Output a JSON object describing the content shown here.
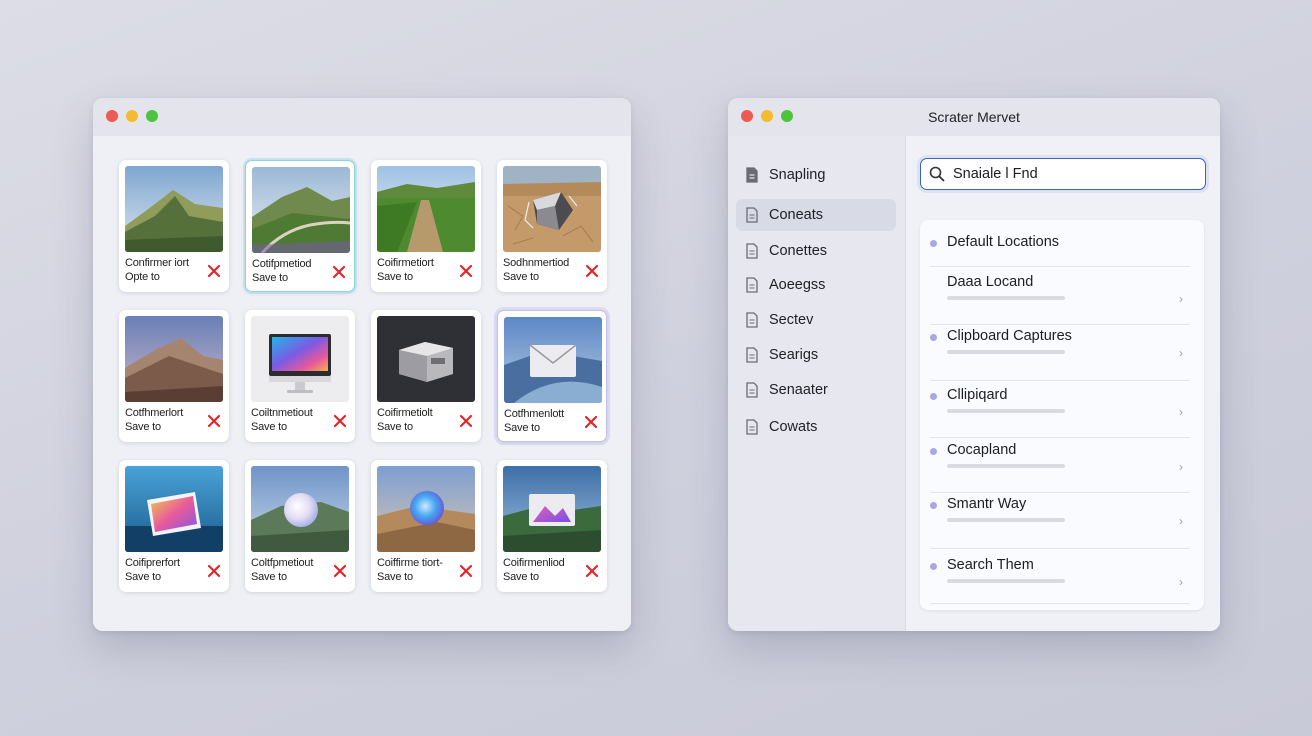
{
  "left_window": {
    "cards": [
      {
        "line1": "Confirmer iort",
        "line2": "Opte to",
        "thumb": "mountain-green"
      },
      {
        "line1": "Cotifpmetiod",
        "line2": "Save to",
        "thumb": "mountain-road"
      },
      {
        "line1": "Coifirmetiort",
        "line2": "Save to",
        "thumb": "field-path"
      },
      {
        "line1": "Sodhnmertiod",
        "line2": "Save to",
        "thumb": "desert-box"
      },
      {
        "line1": "Cotfhmerlort",
        "line2": "Save to",
        "thumb": "mountain-dusk"
      },
      {
        "line1": "Coiltnmetiout",
        "line2": "Save to",
        "thumb": "imac"
      },
      {
        "line1": "Coifirmetiolt",
        "line2": "Save to",
        "thumb": "box-dark"
      },
      {
        "line1": "Cotfhmenlott",
        "line2": "Save to",
        "thumb": "envelope-road"
      },
      {
        "line1": "Coifiprerfort",
        "line2": "Save to",
        "thumb": "folder-colorful"
      },
      {
        "line1": "Coltfpmetiout",
        "line2": "Save to",
        "thumb": "orb-mountain"
      },
      {
        "line1": "Coiffirme tiort-",
        "line2": "Save to",
        "thumb": "orb-desert"
      },
      {
        "line1": "Coifirmenliod",
        "line2": "Save to",
        "thumb": "envelope-forest"
      }
    ]
  },
  "right_window": {
    "title": "Scrater Mervet",
    "sidebar": [
      {
        "label": "Snapling",
        "icon": "document-icon"
      },
      {
        "label": "Coneats",
        "icon": "document-icon",
        "active": true
      },
      {
        "label": "Conettes",
        "icon": "document-icon"
      },
      {
        "label": "Aoeegss",
        "icon": "document-icon"
      },
      {
        "label": "Sectev",
        "icon": "document-icon"
      },
      {
        "label": "Searigs",
        "icon": "document-icon"
      },
      {
        "label": "Senaater",
        "icon": "document-icon"
      },
      {
        "label": "Cowats",
        "icon": "document-icon"
      }
    ],
    "search": {
      "value": "Snaiale l Fnd"
    },
    "list": [
      {
        "label": "Default Locations",
        "dot": true,
        "bar": false
      },
      {
        "label": "Daaa Locand",
        "dot": false,
        "bar": true
      },
      {
        "label": "Clipboard Captures",
        "dot": true,
        "bar": true
      },
      {
        "label": "Cllipiqard",
        "dot": true,
        "bar": true
      },
      {
        "label": "Cocapland",
        "dot": true,
        "bar": true
      },
      {
        "label": "Smantr Way",
        "dot": true,
        "bar": true
      },
      {
        "label": "Search Them",
        "dot": true,
        "bar": true
      }
    ]
  },
  "colors": {
    "accent": "#3a63b8",
    "delete": "#e0252b",
    "list_dot": "#a9a8e0"
  }
}
